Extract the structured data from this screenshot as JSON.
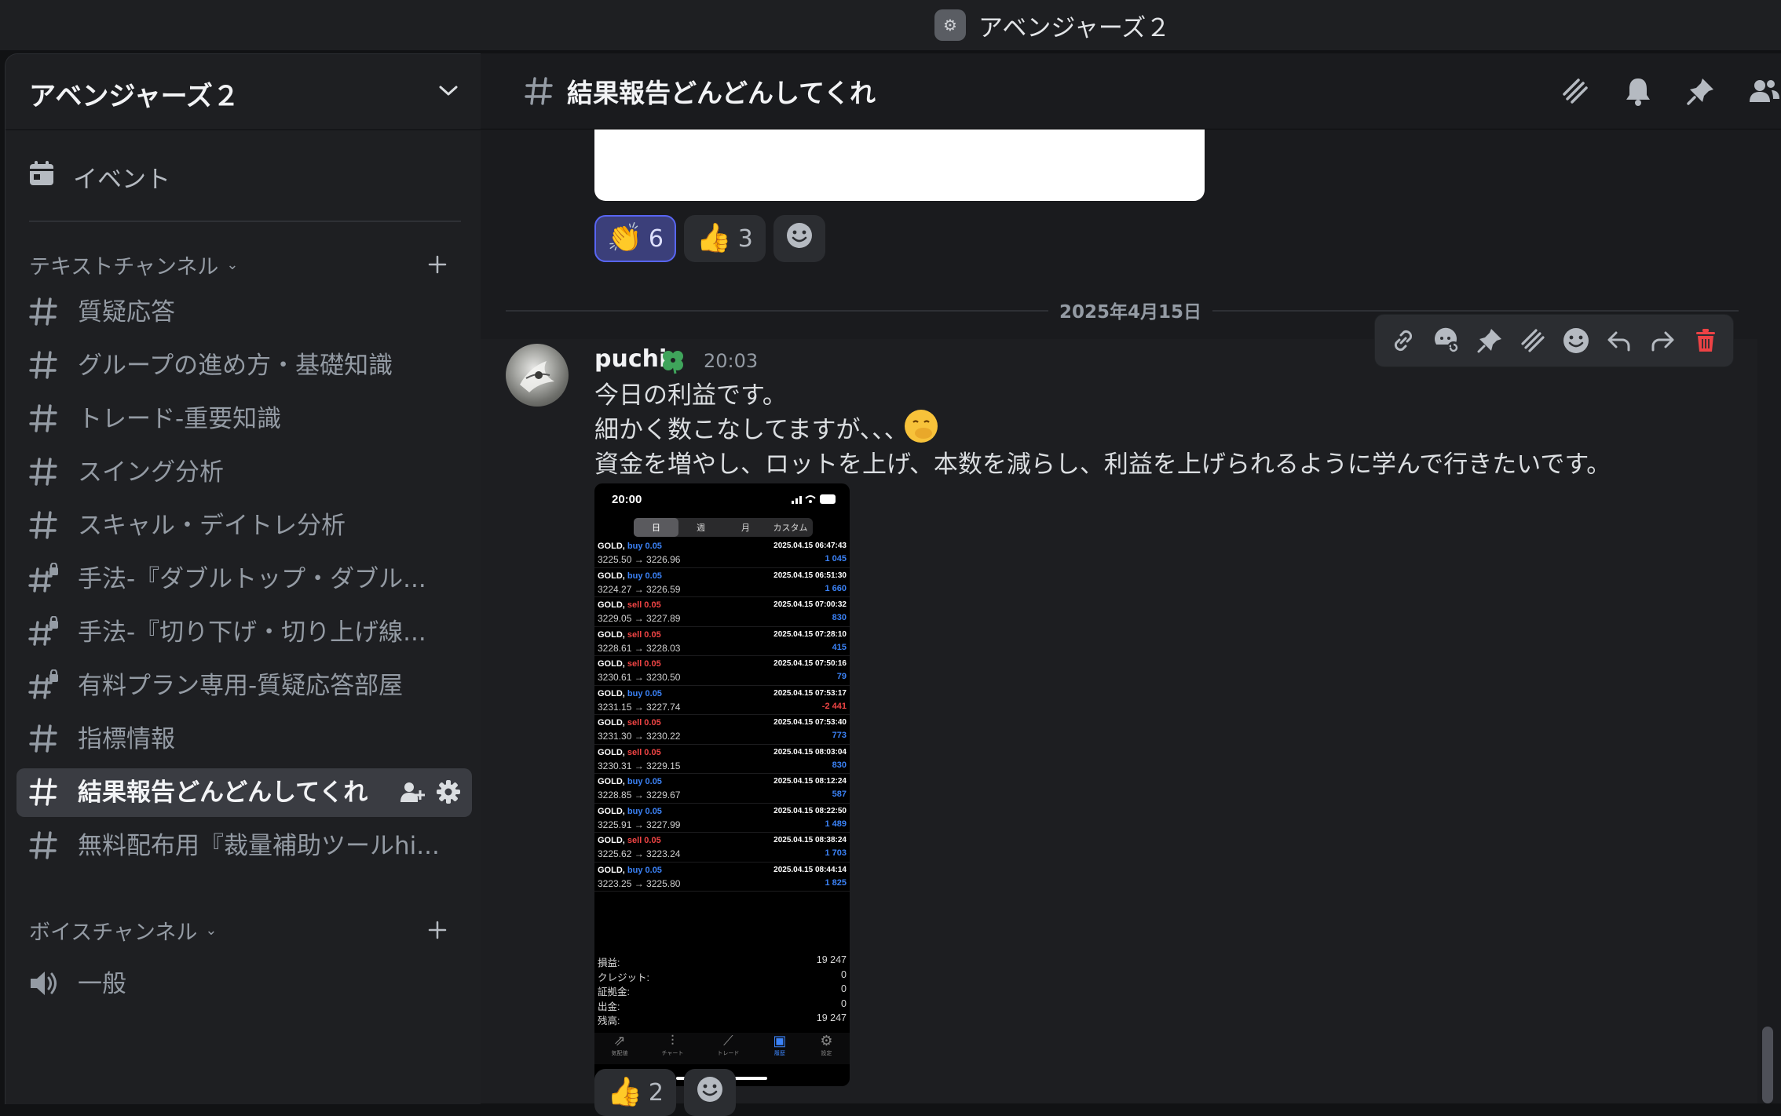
{
  "window": {
    "title": "アベンジャーズ２",
    "app_icon_glyph": "⚙"
  },
  "sidebar": {
    "server_name": "アベンジャーズ２",
    "events_label": "イベント",
    "text_category": "テキストチャンネル",
    "voice_category": "ボイスチャンネル",
    "text_channels": [
      {
        "label": "質疑応答",
        "locked": false
      },
      {
        "label": "グループの進め方・基礎知識",
        "locked": false
      },
      {
        "label": "トレード-重要知識",
        "locked": false
      },
      {
        "label": "スイング分析",
        "locked": false
      },
      {
        "label": "スキャル・デイトレ分析",
        "locked": false
      },
      {
        "label": "手法-『ダブルトップ・ダブル...",
        "locked": true
      },
      {
        "label": "手法-『切り下げ・切り上げ線...",
        "locked": true
      },
      {
        "label": "有料プラン専用-質疑応答部屋",
        "locked": true
      },
      {
        "label": "指標情報",
        "locked": false
      },
      {
        "label": "結果報告どんどんしてくれ",
        "locked": false,
        "active": true
      },
      {
        "label": "無料配布用『裁量補助ツールhi...",
        "locked": false
      }
    ],
    "voice_channels": [
      {
        "label": "一般"
      }
    ]
  },
  "header": {
    "channel_name": "結果報告どんどんしてくれ",
    "icons": [
      "threads-icon",
      "bell-icon",
      "pin-icon",
      "members-icon"
    ]
  },
  "prev_message": {
    "reactions": [
      {
        "emoji": "👏",
        "count": "6",
        "selected": true
      },
      {
        "emoji": "👍",
        "count": "3",
        "selected": false
      }
    ]
  },
  "date_divider": "2025年4月15日",
  "message": {
    "username": "puchi",
    "timestamp": "20:03",
    "lines": [
      "今日の利益です。",
      "細かく数こなしてますが､､､",
      "資金を増やし、ロットを上げ、本数を減らし、利益を上げられるように学んで行きたいです。"
    ],
    "reactions": [
      {
        "emoji": "👍",
        "count": "2"
      }
    ],
    "toolbar": [
      "link-icon",
      "emoji-reset-icon",
      "pin-icon",
      "thread-icon",
      "add-reaction-icon",
      "reply-icon",
      "forward-icon",
      "delete-icon"
    ]
  },
  "attachment": {
    "time": "20:00",
    "tabs": [
      "日",
      "週",
      "月",
      "カスタム"
    ],
    "trades": [
      {
        "sym": "GOLD,",
        "side": "buy 0.05",
        "price": "3225.50 → 3226.96",
        "date": "2025.04.15 06:47:43",
        "pl": "1 045"
      },
      {
        "sym": "GOLD,",
        "side": "buy 0.05",
        "price": "3224.27 → 3226.59",
        "date": "2025.04.15 06:51:30",
        "pl": "1 660"
      },
      {
        "sym": "GOLD,",
        "side": "sell 0.05",
        "price": "3229.05 → 3227.89",
        "date": "2025.04.15 07:00:32",
        "pl": "830"
      },
      {
        "sym": "GOLD,",
        "side": "sell 0.05",
        "price": "3228.61 → 3228.03",
        "date": "2025.04.15 07:28:10",
        "pl": "415"
      },
      {
        "sym": "GOLD,",
        "side": "sell 0.05",
        "price": "3230.61 → 3230.50",
        "date": "2025.04.15 07:50:16",
        "pl": "79"
      },
      {
        "sym": "GOLD,",
        "side": "buy 0.05",
        "price": "3231.15 → 3227.74",
        "date": "2025.04.15 07:53:17",
        "pl": "-2 441"
      },
      {
        "sym": "GOLD,",
        "side": "sell 0.05",
        "price": "3231.30 → 3230.22",
        "date": "2025.04.15 07:53:40",
        "pl": "773"
      },
      {
        "sym": "GOLD,",
        "side": "sell 0.05",
        "price": "3230.31 → 3229.15",
        "date": "2025.04.15 08:03:04",
        "pl": "830"
      },
      {
        "sym": "GOLD,",
        "side": "buy 0.05",
        "price": "3228.85 → 3229.67",
        "date": "2025.04.15 08:12:24",
        "pl": "587"
      },
      {
        "sym": "GOLD,",
        "side": "buy 0.05",
        "price": "3225.91 → 3227.99",
        "date": "2025.04.15 08:22:50",
        "pl": "1 489"
      },
      {
        "sym": "GOLD,",
        "side": "sell 0.05",
        "price": "3225.62 → 3223.24",
        "date": "2025.04.15 08:38:24",
        "pl": "1 703"
      },
      {
        "sym": "GOLD,",
        "side": "buy 0.05",
        "price": "3223.25 → 3225.80",
        "date": "2025.04.15 08:44:14",
        "pl": "1 825"
      }
    ],
    "summary": [
      {
        "label": "損益:",
        "value": "19 247"
      },
      {
        "label": "クレジット:",
        "value": "0"
      },
      {
        "label": "証拠金:",
        "value": "0"
      },
      {
        "label": "出金:",
        "value": "0"
      },
      {
        "label": "残高:",
        "value": "19 247"
      }
    ],
    "nav": [
      "気配値",
      "チャート",
      "トレード",
      "履歴",
      "設定"
    ],
    "nav_selected": 3
  },
  "colors": {
    "accent": "#5865f2",
    "buy": "#3b82f6",
    "sell": "#ef4444",
    "delete": "#ed4245"
  }
}
